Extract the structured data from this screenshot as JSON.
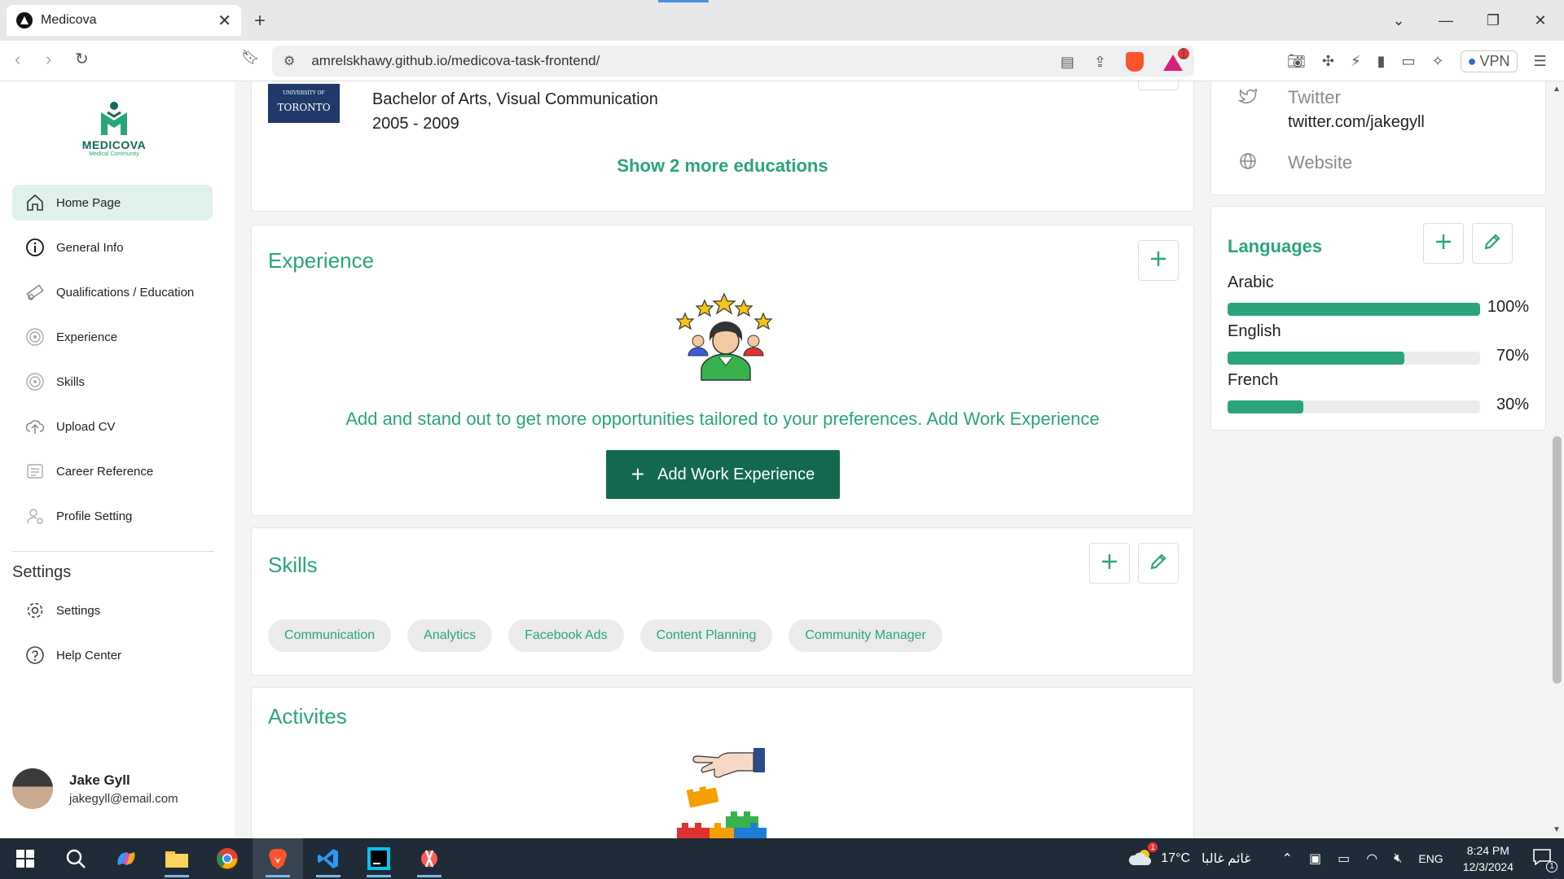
{
  "browser": {
    "tab_title": "Medicova",
    "url": "amrelskhawy.github.io/medicova-task-frontend/",
    "vpn_label": "VPN",
    "rewards_badge": "1"
  },
  "logo": {
    "name": "MEDICOVA",
    "tagline": "Medical Community"
  },
  "sidebar": {
    "items": [
      {
        "label": "Home Page",
        "icon": "home-icon"
      },
      {
        "label": "General Info",
        "icon": "info-icon"
      },
      {
        "label": "Qualifications / Education",
        "icon": "diploma-icon"
      },
      {
        "label": "Experience",
        "icon": "experience-icon"
      },
      {
        "label": "Skills",
        "icon": "skills-icon"
      },
      {
        "label": "Upload CV",
        "icon": "upload-icon"
      },
      {
        "label": "Career Reference",
        "icon": "reference-icon"
      },
      {
        "label": "Profile Setting",
        "icon": "profile-setting-icon"
      }
    ],
    "settings_title": "Settings",
    "settings_items": [
      {
        "label": "Settings",
        "icon": "gear-icon"
      },
      {
        "label": "Help Center",
        "icon": "help-icon"
      }
    ],
    "user": {
      "name": "Jake Gyll",
      "email": "jakegyll@email.com"
    }
  },
  "education": {
    "logo_text": "TORONTO",
    "logo_small": "UNIVERSITY OF",
    "degree": "Bachelor of Arts, Visual Communication",
    "years": "2005 - 2009",
    "show_more": "Show 2 more educations"
  },
  "experience": {
    "title": "Experience",
    "empty_text": "Add and stand out to get more opportunities tailored to your preferences. Add Work Experience",
    "button": "Add Work Experience"
  },
  "skills": {
    "title": "Skills",
    "items": [
      "Communication",
      "Analytics",
      "Facebook Ads",
      "Content Planning",
      "Community Manager"
    ]
  },
  "activities": {
    "title": "Activites"
  },
  "contacts": {
    "twitter_label": "Twitter",
    "twitter_value": "twitter.com/jakegyll",
    "website_label": "Website"
  },
  "languages": {
    "title": "Languages",
    "items": [
      {
        "name": "Arabic",
        "percent": "100%",
        "level": 1.0
      },
      {
        "name": "English",
        "percent": "70%",
        "level": 0.7
      },
      {
        "name": "French",
        "percent": "30%",
        "level": 0.3
      }
    ]
  },
  "taskbar": {
    "weather": "17°C",
    "weather_text": "غائم غالبا",
    "lang": "ENG",
    "time": "8:24 PM",
    "date": "12/3/2024",
    "notif_count": "1",
    "weather_badge": "1"
  },
  "colors": {
    "accent": "#2aa57a",
    "button": "#12694f",
    "active_nav": "#dff1ea"
  }
}
